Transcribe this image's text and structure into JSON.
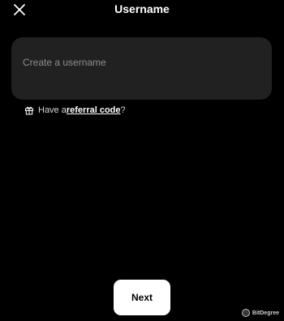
{
  "header": {
    "title": "Username",
    "close_icon": "close-icon"
  },
  "form": {
    "username_value": "",
    "username_placeholder": "Create a username"
  },
  "referral": {
    "icon": "gift-icon",
    "prefix": "Have a ",
    "link_label": "referral code",
    "suffix": "?"
  },
  "footer": {
    "next_label": "Next"
  },
  "watermark": {
    "text": "BitDegree"
  },
  "colors": {
    "background": "#000000",
    "input_background": "#212121",
    "button_background": "#ffffff",
    "button_text": "#000000"
  }
}
